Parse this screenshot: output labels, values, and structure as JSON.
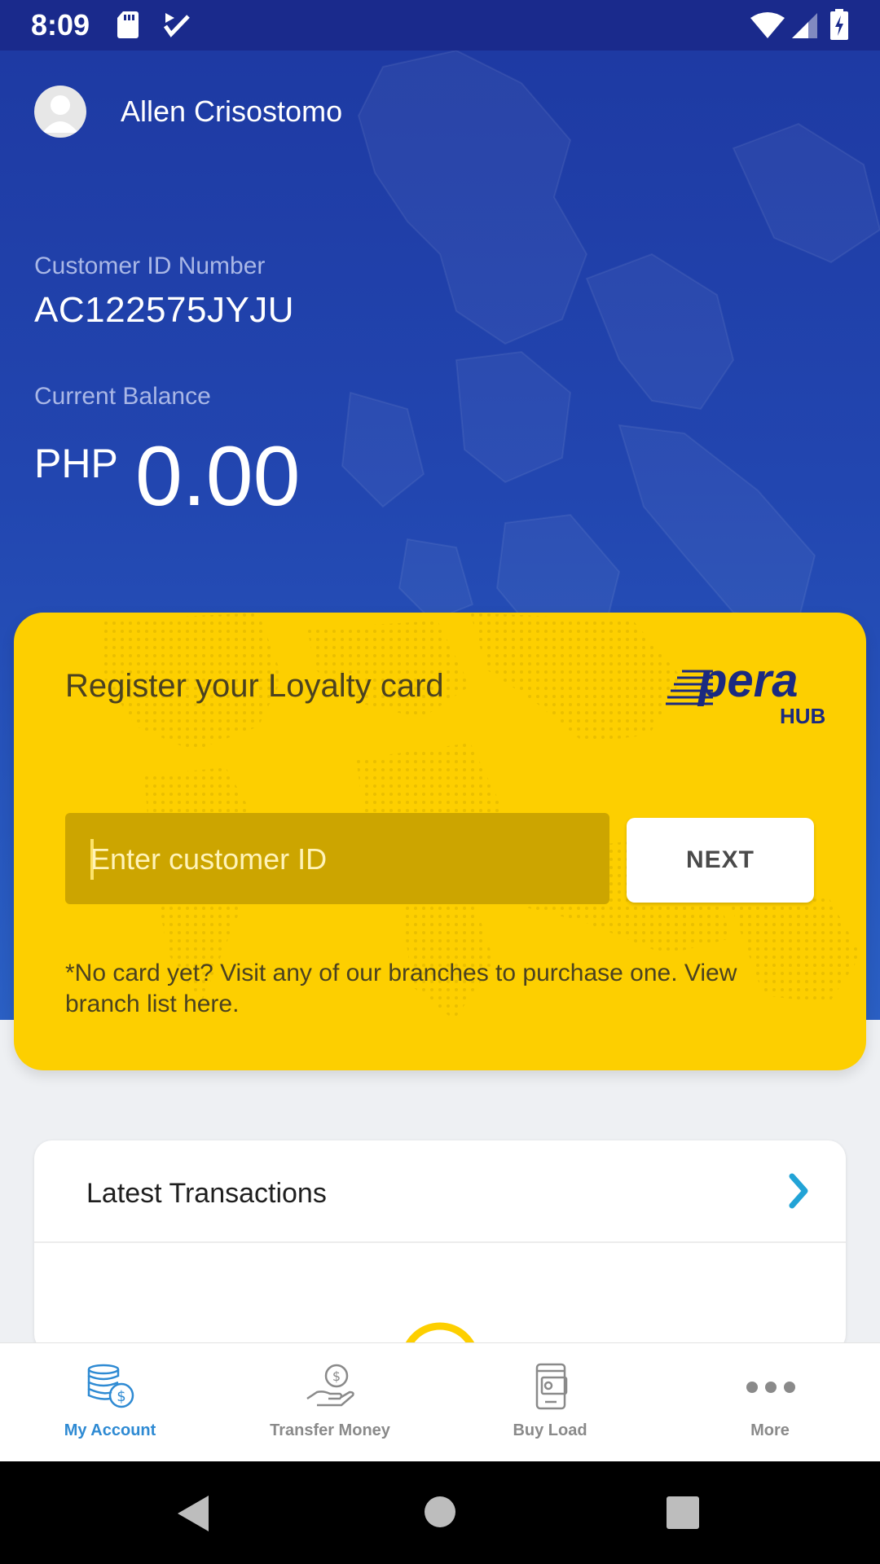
{
  "status_bar": {
    "time": "8:09"
  },
  "user": {
    "name": "Allen Crisostomo"
  },
  "account": {
    "customer_id_label": "Customer ID Number",
    "customer_id": "AC122575JYJU",
    "balance_label": "Current Balance",
    "currency": "PHP",
    "balance": "0.00"
  },
  "loyalty": {
    "title": "Register your Loyalty card",
    "brand_word": "pera",
    "brand_sub": "HUB",
    "input_placeholder": "Enter customer ID",
    "next_label": "NEXT",
    "note": "*No card yet? Visit any of our branches to purchase one. View branch list here."
  },
  "transactions": {
    "title": "Latest Transactions"
  },
  "bottom_nav": {
    "items": [
      {
        "label": "My Account",
        "icon": "coins-icon",
        "active": true
      },
      {
        "label": "Transfer Money",
        "icon": "hand-money-icon",
        "active": false
      },
      {
        "label": "Buy Load",
        "icon": "phone-load-icon",
        "active": false
      },
      {
        "label": "More",
        "icon": "more-dots-icon",
        "active": false
      }
    ]
  },
  "colors": {
    "hero_blue": "#1e3aa3",
    "card_yellow": "#fdcf00",
    "accent_blue": "#2e8ad3"
  }
}
